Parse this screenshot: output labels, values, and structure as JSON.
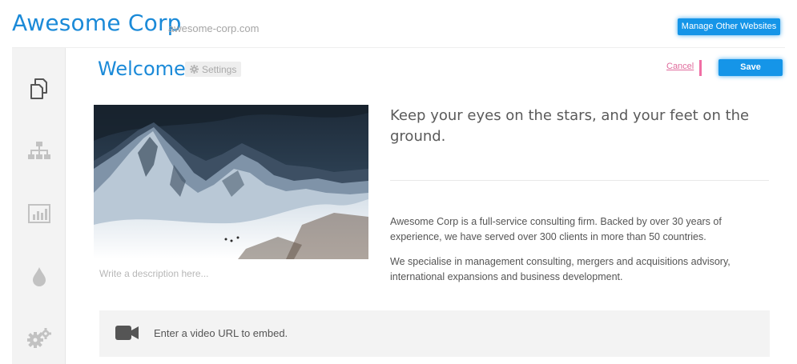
{
  "header": {
    "brand": "Awesome Corp",
    "domain": "awesome-corp.com",
    "manage_label": "Manage Other Websites"
  },
  "sidebar": {
    "items": [
      {
        "icon": "pages-icon",
        "active": true
      },
      {
        "icon": "sitemap-icon",
        "active": false
      },
      {
        "icon": "analytics-icon",
        "active": false
      },
      {
        "icon": "drop-icon",
        "active": false
      },
      {
        "icon": "gears-icon",
        "active": false
      }
    ]
  },
  "page": {
    "title": "Welcome",
    "settings_label": "Settings",
    "cancel_label": "Cancel",
    "save_label": "Save"
  },
  "content": {
    "image_alt": "snowy mountain range under dark clouds",
    "image_description_placeholder": "Write a description here...",
    "quote": "Keep your eyes on the stars, and your feet on the ground.",
    "paragraph1": "Awesome Corp is a full-service consulting firm. Backed by over 30 years of experience, we have served over 300 clients in more than 50 countries.",
    "paragraph2": "We specialise in management consulting, mergers and acquisitions advisory, international expansions and business development.",
    "video_placeholder": "Enter a video URL to embed."
  },
  "colors": {
    "accent": "#1b8ad8",
    "button": "#1595e8",
    "cancel": "#e06b9c"
  }
}
